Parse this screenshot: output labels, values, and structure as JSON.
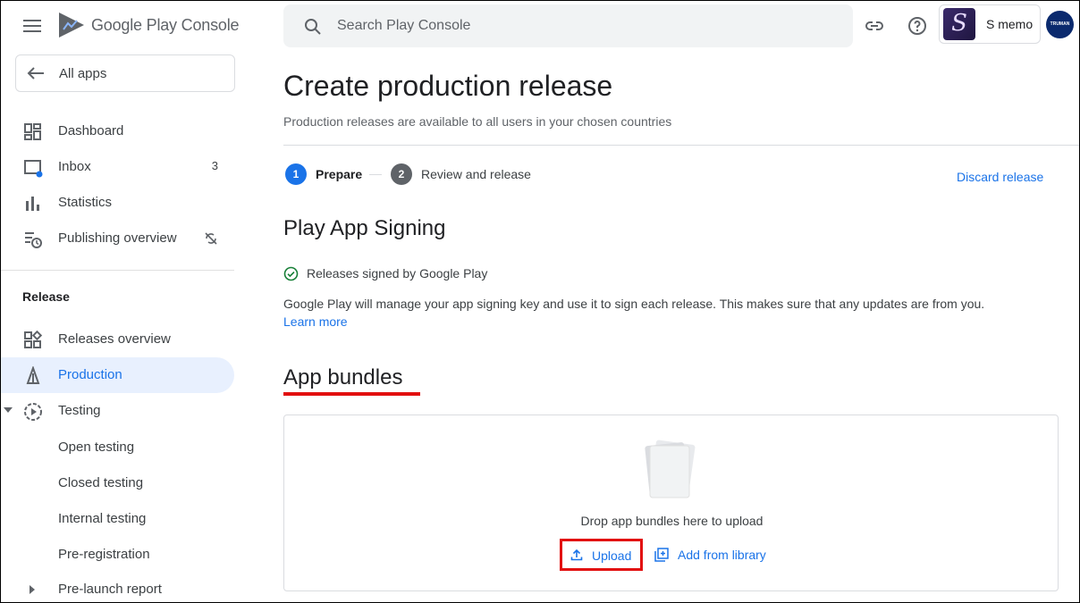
{
  "header": {
    "brand": "Google Play Console",
    "search_placeholder": "Search Play Console",
    "app_name": "S memo",
    "app_thumb_letter": "S",
    "avatar_text": "TRUMAN",
    "link_icon": "link-icon",
    "help_icon": "help-icon"
  },
  "sidebar": {
    "all_apps": "All apps",
    "items": [
      {
        "label": "Dashboard",
        "icon": "dashboard-icon"
      },
      {
        "label": "Inbox",
        "icon": "inbox-icon",
        "badge": "3"
      },
      {
        "label": "Statistics",
        "icon": "statistics-icon"
      },
      {
        "label": "Publishing overview",
        "icon": "publishing-icon"
      }
    ],
    "section": "Release",
    "release_items": [
      {
        "label": "Releases overview",
        "icon": "releases-overview-icon"
      },
      {
        "label": "Production",
        "icon": "production-icon"
      },
      {
        "label": "Testing",
        "icon": "testing-icon"
      }
    ],
    "testing_sub": [
      "Open testing",
      "Closed testing",
      "Internal testing",
      "Pre-registration"
    ],
    "prelaunch": "Pre-launch report"
  },
  "main": {
    "title": "Create production release",
    "subtitle": "Production releases are available to all users in your chosen countries",
    "steps": [
      {
        "num": "1",
        "label": "Prepare"
      },
      {
        "num": "2",
        "label": "Review and release"
      }
    ],
    "discard": "Discard release",
    "signing_title": "Play App Signing",
    "signed_text": "Releases signed by Google Play",
    "signing_para": "Google Play will manage your app signing key and use it to sign each release. This makes sure that any updates are from you.",
    "learn_more": "Learn more",
    "bundles_title": "App bundles",
    "drop_text": "Drop app bundles here to upload",
    "upload": "Upload",
    "add_library": "Add from library"
  },
  "colors": {
    "accent": "#1a73e8",
    "highlight_red": "#e20f0f",
    "active_bg": "#e8f0fe",
    "step_inactive": "#5f6368",
    "success": "#188038"
  }
}
